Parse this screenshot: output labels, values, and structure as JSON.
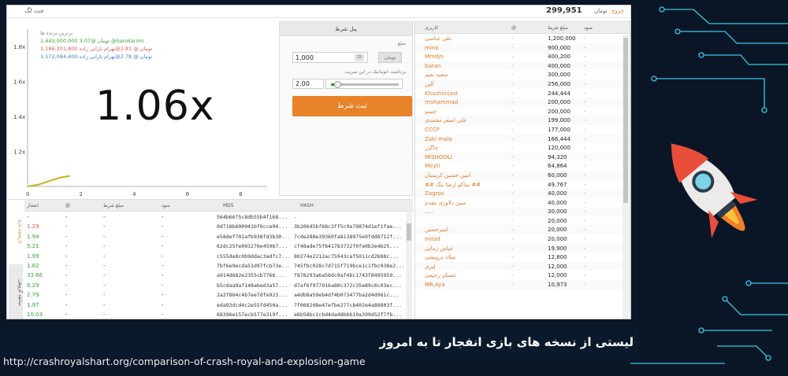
{
  "topbar": {
    "brand": "جت لگ",
    "balance": "299,951",
    "currency": "تومان",
    "exit": "خروج"
  },
  "chart": {
    "multiplier": "1.06x",
    "winners_title": "برترین برنده ها",
    "winners": [
      {
        "text": "1,443,000,000 3.07@ تومان @Sarokarimi",
        "color": "#3aa13a"
      },
      {
        "text": "1,186,201,800 تومان @ 2.81@بهرام بارانی زاده",
        "color": "#e05555"
      },
      {
        "text": "1,172,084,400 تومان @ 2.78@بهرام بارانی زاده",
        "color": "#3a7fd0"
      }
    ],
    "y_ticks": [
      "1.8x",
      "1.6x",
      "1.4x",
      "1.2x"
    ],
    "x_ticks": [
      "0",
      "2",
      "4",
      "6",
      "8"
    ]
  },
  "chart_data": {
    "type": "line",
    "x": [
      0,
      0.4,
      0.8,
      1.2,
      1.6
    ],
    "y": [
      1.0,
      1.01,
      1.03,
      1.05,
      1.06
    ],
    "xlim": [
      0,
      9
    ],
    "ylim": [
      1.0,
      1.9
    ]
  },
  "bet_panel": {
    "title": "پنل شرط",
    "amount_label": "مبلغ",
    "amount_value": "1,000",
    "amount_badge": "25",
    "currency_button": "تومان",
    "auto_label": "برداشت اتوماتیک در این ضریب",
    "auto_value": "2.00",
    "submit": "ثبت شرط"
  },
  "players": {
    "headers": [
      "کاربری",
      "@",
      "مبلغ شرط",
      "سود"
    ],
    "rows": [
      {
        "name": "علی عباسی",
        "at": "-",
        "amount": "1,200,000",
        "profit": "-"
      },
      {
        "name": "mino",
        "at": "-",
        "amount": "900,000",
        "profit": "-"
      },
      {
        "name": "Mmdjn",
        "at": "-",
        "amount": "400,200",
        "profit": "-"
      },
      {
        "name": "baran",
        "at": "-",
        "amount": "400,000",
        "profit": "-"
      },
      {
        "name": "سعید نعیم",
        "at": "-",
        "amount": "300,000",
        "profit": "-"
      },
      {
        "name": "الین",
        "at": "-",
        "amount": "256,000",
        "profit": "-"
      },
      {
        "name": "Khashiinjast",
        "at": "-",
        "amount": "244,444",
        "profit": "-"
      },
      {
        "name": "mohammad",
        "at": "-",
        "amount": "200,000",
        "profit": "-"
      },
      {
        "name": "جسم",
        "at": "-",
        "amount": "200,000",
        "profit": "-"
      },
      {
        "name": "علی اصغر محمدی",
        "at": "-",
        "amount": "199,000",
        "profit": "-"
      },
      {
        "name": "CCCP",
        "at": "-",
        "amount": "177,000",
        "profit": "-"
      },
      {
        "name": "Zaki mala",
        "at": "-",
        "amount": "166,444",
        "profit": "-"
      },
      {
        "name": "چاگزر",
        "at": "-",
        "amount": "120,000",
        "profit": "-"
      },
      {
        "name": "MISHOOLI",
        "at": "-",
        "amount": "94,320",
        "profit": "-"
      },
      {
        "name": "Meyti",
        "at": "-",
        "amount": "64,864",
        "profit": "-"
      },
      {
        "name": "امین حسین کریمیان",
        "at": "-",
        "amount": "60,000",
        "profit": "-"
      },
      {
        "name": "## ساکو ارضا بیگ ##",
        "at": "-",
        "amount": "49,767",
        "profit": "-"
      },
      {
        "name": "Zagros",
        "at": "-",
        "amount": "40,000",
        "profit": "-"
      },
      {
        "name": "مبین دلاوری مقدم",
        "at": "-",
        "amount": "40,000",
        "profit": "-"
      },
      {
        "name": ".....",
        "at": "-",
        "amount": "30,000",
        "profit": "-"
      },
      {
        "name": "",
        "at": "-",
        "amount": "20,000",
        "profit": "-"
      },
      {
        "name": "امیرحسین",
        "at": "-",
        "amount": "20,000",
        "profit": "-"
      },
      {
        "name": "milad",
        "at": "-",
        "amount": "20,000",
        "profit": "-"
      },
      {
        "name": "عیاس زمانی",
        "at": "-",
        "amount": "19,900",
        "profit": "-"
      },
      {
        "name": "میلاد درویشی",
        "at": "-",
        "amount": "12,800",
        "profit": "-"
      },
      {
        "name": "لیزی",
        "at": "-",
        "amount": "12,000",
        "profit": "-"
      },
      {
        "name": "عسکر رحیمی",
        "at": "-",
        "amount": "12,000",
        "profit": "-"
      },
      {
        "name": "MR.Aya",
        "at": "-",
        "amount": "10,973",
        "profit": "-"
      }
    ]
  },
  "history": {
    "tab_crash": "تاریخچه بازی",
    "tab_my": "سابقه گروهی",
    "headers": [
      "انفجار",
      "@",
      "مبلغ شرط",
      "سود",
      "MD5",
      "HASH"
    ],
    "rows": [
      {
        "crash": "-",
        "color": "#333",
        "at": "-",
        "bet": "-",
        "profit": "-",
        "md5": "564b6675c8db55b4f168...",
        "hash": "-"
      },
      {
        "crash": "1.29",
        "color": "#e05555",
        "at": "-",
        "bet": "-",
        "profit": "-",
        "md5": "0d718b600941bf0cce94...",
        "hash": "3b20645bf68c3ff5c9e79874d1ef1fae..."
      },
      {
        "crash": "1.94",
        "color": "#3aa13a",
        "at": "-",
        "bet": "-",
        "profit": "-",
        "md5": "e58def701afb938fd3b30...",
        "hash": "7cde288e39360fa8138975e9fdd8712f..."
      },
      {
        "crash": "5.21",
        "color": "#3aa13a",
        "at": "-",
        "bet": "-",
        "profit": "-",
        "md5": "62dc25fe093276e45967...",
        "hash": "cf48ade75f641783732f0fe0b2e4b25..."
      },
      {
        "crash": "1.99",
        "color": "#3aa13a",
        "at": "-",
        "bet": "-",
        "profit": "-",
        "md5": "c555de8c0b9ddac3adfc7...",
        "hash": "80274e2212ac75943caf5011cd2688c..."
      },
      {
        "crash": "1.82",
        "color": "#3aa13a",
        "at": "-",
        "bet": "-",
        "profit": "-",
        "md5": "7bf6e9ecda51d97fcb73e...",
        "hash": "745fbc028c7d715f719bce1c1fbc038e2..."
      },
      {
        "crash": "33.66",
        "color": "#3aa13a",
        "at": "-",
        "bet": "-",
        "profit": "-",
        "md5": "a914d682e2355cb7766...",
        "hash": "f878293a6a58dc9af4bc1743f8495959..."
      },
      {
        "crash": "6.29",
        "color": "#3aa13a",
        "at": "-",
        "bet": "-",
        "profit": "-",
        "md5": "b5cdaa9af148abed3a57...",
        "hash": "d7af6f977916a80c372c35e89c0c03ec..."
      },
      {
        "crash": "2.79",
        "color": "#3aa13a",
        "at": "-",
        "bet": "-",
        "profit": "-",
        "md5": "2a2f864c4b7ee7dfe923...",
        "hash": "a4db8a59eb4df4b073477ba2d4d961c..."
      },
      {
        "crash": "1.97",
        "color": "#3aa13a",
        "at": "-",
        "bet": "-",
        "profit": "-",
        "md5": "eda93dcd4c2e55fd450a...",
        "hash": "7f0682d8e47efbe277cb402e4a88803f..."
      },
      {
        "crash": "10.03",
        "color": "#3aa13a",
        "at": "-",
        "bet": "-",
        "profit": "-",
        "md5": "68396e157ecb577e319f...",
        "hash": "e6b58bc1cbd4da48bbb19a399d52f7fb..."
      }
    ]
  },
  "caption": {
    "title": "لیستی از نسخه های بازی انفجار تا به امروز",
    "url": "http://crashroyalshart.org/comparison-of-crash-royal-and-explosion-game"
  },
  "colors": {
    "accent": "#e8832a",
    "background": "#0a1626",
    "rocket": "#e94e3a"
  }
}
